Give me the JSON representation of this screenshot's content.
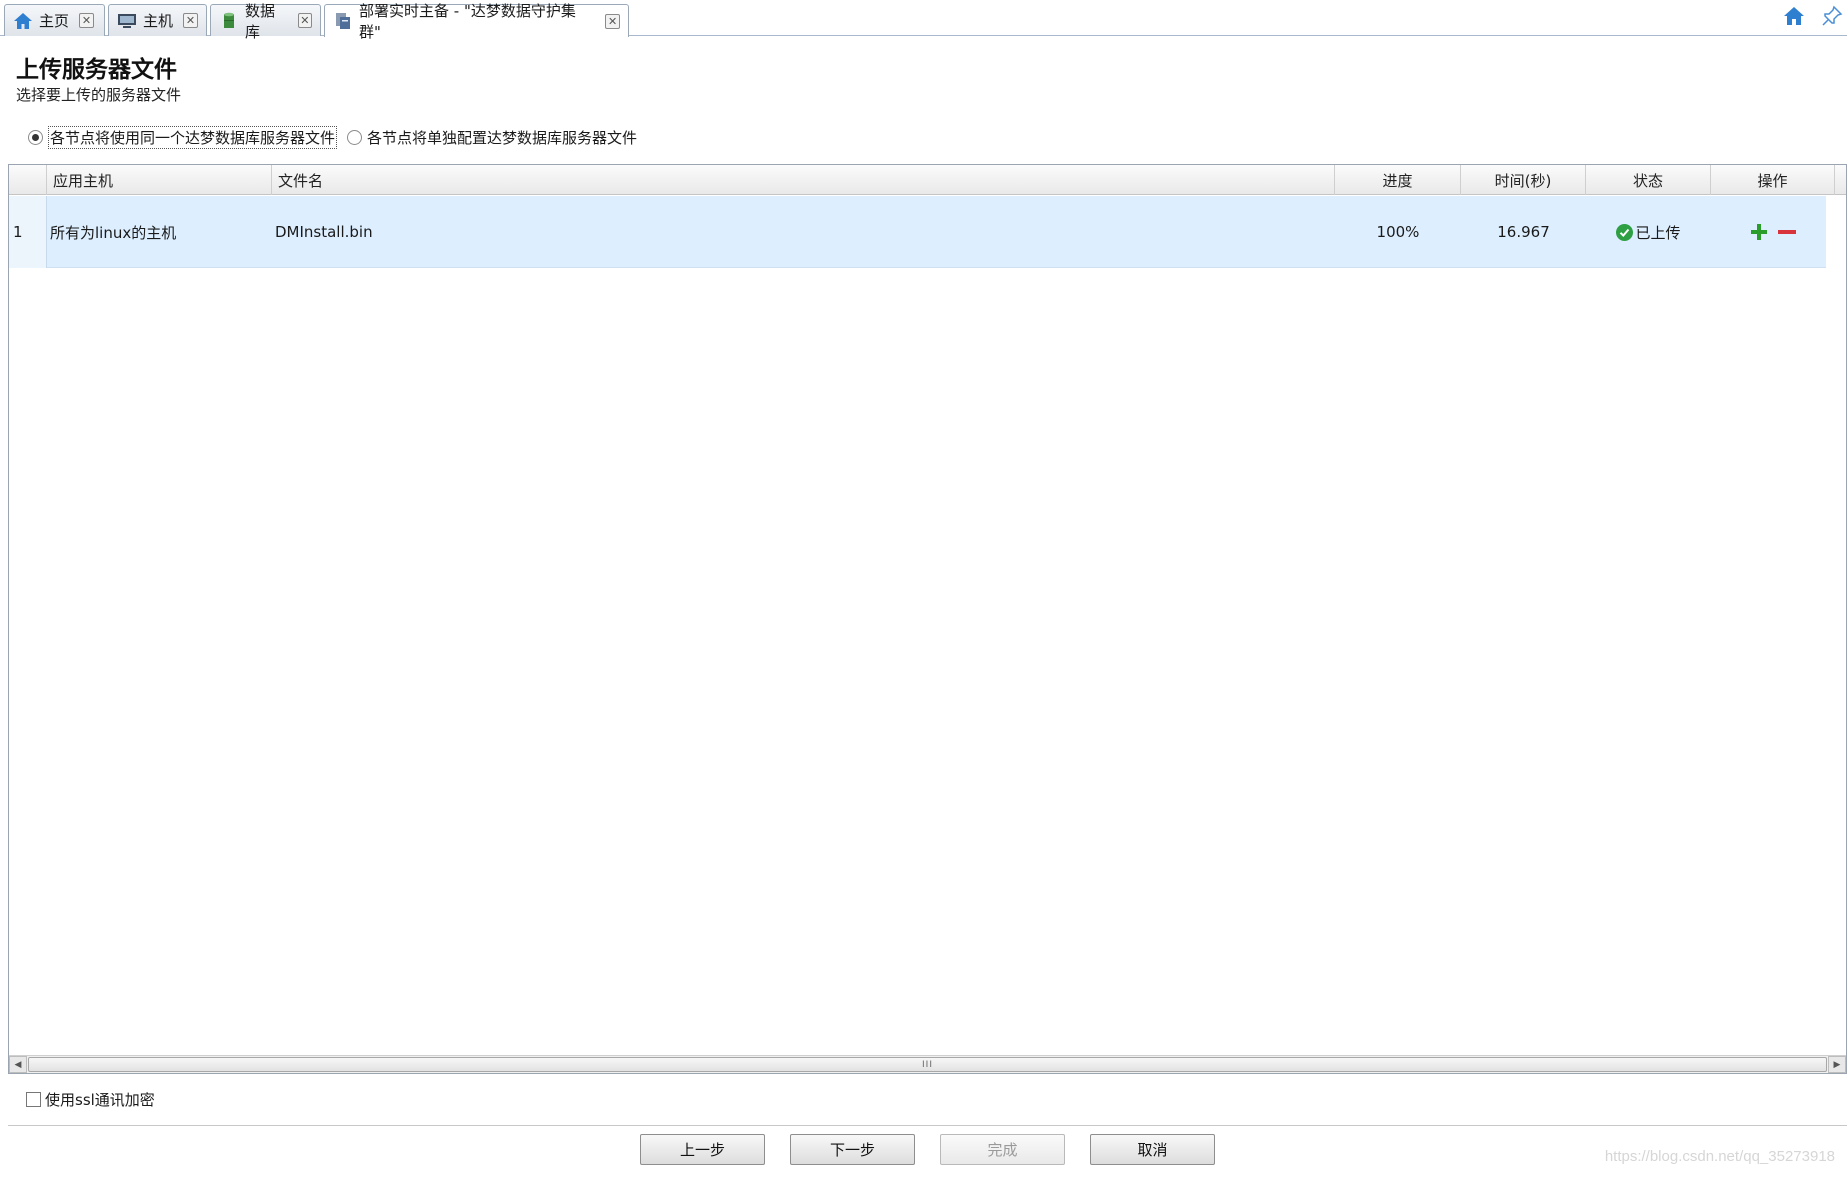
{
  "tabs": [
    {
      "label": "主页",
      "icon": "home-icon"
    },
    {
      "label": "主机",
      "icon": "computer-icon"
    },
    {
      "label": "数据库",
      "icon": "database-icon"
    },
    {
      "label": "部署实时主备 - \"达梦数据守护集群\"",
      "icon": "deploy-icon"
    }
  ],
  "header": {
    "title": "上传服务器文件",
    "subtitle": "选择要上传的服务器文件"
  },
  "options": {
    "same_file": "各节点将使用同一个达梦数据库服务器文件",
    "separate_file": "各节点将单独配置达梦数据库服务器文件",
    "selected": "same_file"
  },
  "grid": {
    "columns": [
      "应用主机",
      "文件名",
      "进度",
      "时间(秒)",
      "状态",
      "操作"
    ],
    "rows": [
      {
        "index": "1",
        "host": "所有为linux的主机",
        "file": "DMInstall.bin",
        "progress": "100%",
        "time": "16.967",
        "status": "已上传"
      }
    ],
    "scrollbar_grip": "III"
  },
  "ssl": {
    "label": "使用ssl通讯加密",
    "checked": false
  },
  "buttons": {
    "prev": "上一步",
    "next": "下一步",
    "finish": "完成",
    "cancel": "取消"
  },
  "watermark": "https://blog.csdn.net/qq_35273918",
  "colors": {
    "row_selected": "#ddeeff",
    "status_ok": "#2ea043",
    "add": "#2a9d2a",
    "remove": "#d9343c",
    "home_icon": "#2f7fd1"
  }
}
